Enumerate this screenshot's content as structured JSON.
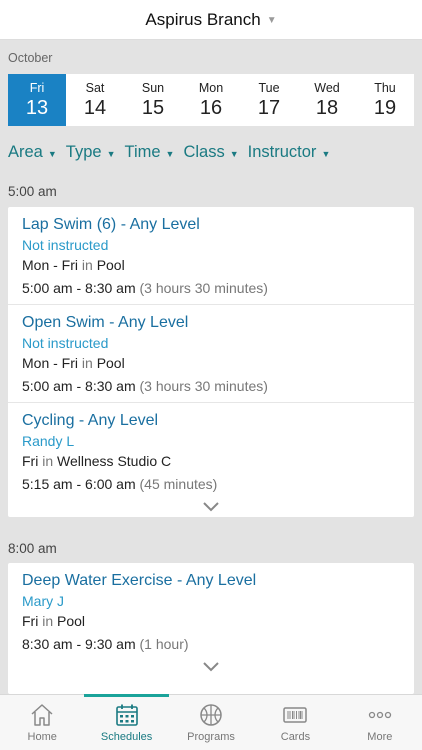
{
  "header": {
    "title": "Aspirus Branch"
  },
  "calendar": {
    "month": "October",
    "days": [
      {
        "name": "Fri",
        "date": "13",
        "active": true
      },
      {
        "name": "Sat",
        "date": "14"
      },
      {
        "name": "Sun",
        "date": "15"
      },
      {
        "name": "Mon",
        "date": "16"
      },
      {
        "name": "Tue",
        "date": "17"
      },
      {
        "name": "Wed",
        "date": "18"
      },
      {
        "name": "Thu",
        "date": "19"
      }
    ]
  },
  "filters": [
    "Area",
    "Type",
    "Time",
    "Class",
    "Instructor"
  ],
  "sections": [
    {
      "time_label": "5:00 am",
      "classes": [
        {
          "name": "Lap Swim (6) - Any Level",
          "instructor": "Not instructed",
          "days": "Mon - Fri",
          "in": "in",
          "location": "Pool",
          "time": "5:00 am - 8:30 am",
          "duration": "(3 hours 30 minutes)"
        },
        {
          "name": "Open Swim - Any Level",
          "instructor": "Not instructed",
          "days": "Mon - Fri",
          "in": "in",
          "location": "Pool",
          "time": "5:00 am - 8:30 am",
          "duration": "(3 hours 30 minutes)"
        },
        {
          "name": "Cycling - Any Level",
          "instructor": "Randy L",
          "days": "Fri",
          "in": "in",
          "location": "Wellness Studio C",
          "time": "5:15 am - 6:00 am",
          "duration": "(45 minutes)"
        }
      ]
    },
    {
      "time_label": "8:00 am",
      "classes": [
        {
          "name": "Deep Water Exercise - Any Level",
          "instructor": "Mary J",
          "days": "Fri",
          "in": "in",
          "location": "Pool",
          "time": "8:30 am - 9:30 am",
          "duration": "(1 hour)"
        }
      ]
    }
  ],
  "tabbar": [
    {
      "label": "Home",
      "icon": "home-icon"
    },
    {
      "label": "Schedules",
      "icon": "calendar-icon",
      "active": true
    },
    {
      "label": "Programs",
      "icon": "basketball-icon"
    },
    {
      "label": "Cards",
      "icon": "barcode-card-icon"
    },
    {
      "label": "More",
      "icon": "more-dots-icon"
    }
  ],
  "colors": {
    "accent": "#1a82c4",
    "teal": "#1a7a82",
    "link": "#1a6fa0"
  }
}
